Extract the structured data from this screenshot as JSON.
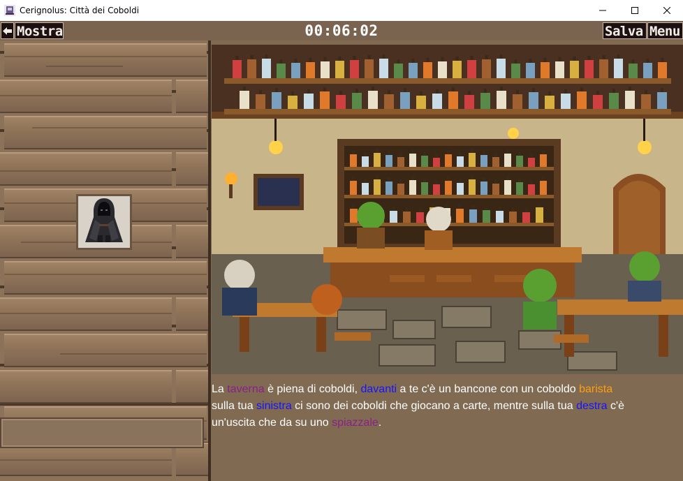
{
  "window": {
    "title": "Cerignolus: Città dei Coboldi",
    "controls": [
      "minimize-icon",
      "maximize-icon",
      "close-icon"
    ]
  },
  "toolbar": {
    "back_icon": "back-arrow-icon",
    "show_label": "Mostra",
    "timer": "00:06:02",
    "save_label": "Salva",
    "menu_label": "Menu"
  },
  "sidebar": {
    "portrait_icon": "hooded-cloaked-figure-icon",
    "inventory_slot": ""
  },
  "scene": {
    "image": "tavern-scene-illustration"
  },
  "description": {
    "line1": {
      "t1": "La ",
      "k1": "taverna",
      "t2": " è piena di coboldi, ",
      "k2": "davanti",
      "t3": " a te c'è un bancone con un coboldo ",
      "k3": "barista"
    },
    "line2": {
      "t1": "sulla tua ",
      "k1": "sinistra",
      "t2": " ci sono dei coboldi che giocano a carte, mentre sulla tua ",
      "k2": "destra",
      "t3": " c'è"
    },
    "line3": {
      "t1": "un'uscita che da su uno ",
      "k1": "spiazzale",
      "t2": "."
    }
  },
  "colors": {
    "keyword_place": "#8a1f8a",
    "keyword_direction": "#1414ff",
    "keyword_character": "#ff9f10",
    "panel_bg": "#806a52",
    "button_bg": "#1c1010"
  }
}
